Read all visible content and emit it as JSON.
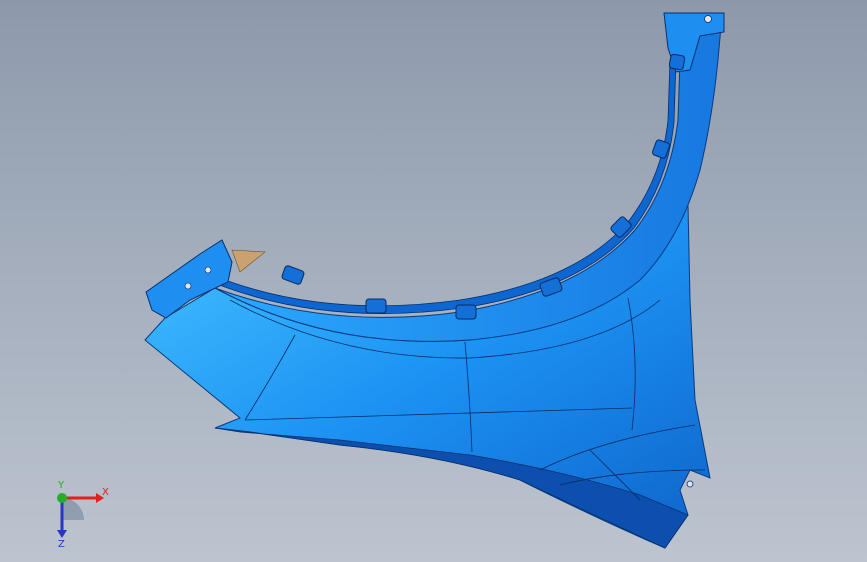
{
  "viewport": {
    "background_top": "#8d99ab",
    "background_bottom": "#bcc4cf"
  },
  "model": {
    "shape": "fender-part",
    "color_light": "#3fc0ff",
    "color_mid": "#1b8ff2",
    "color_dark": "#0d5fc4",
    "edge_color": "#0a2a66"
  },
  "triad": {
    "x_label": "X",
    "y_label": "Y",
    "z_label": "Z",
    "x_color": "#e0201a",
    "y_color": "#22b022",
    "z_color": "#2a34c8"
  }
}
